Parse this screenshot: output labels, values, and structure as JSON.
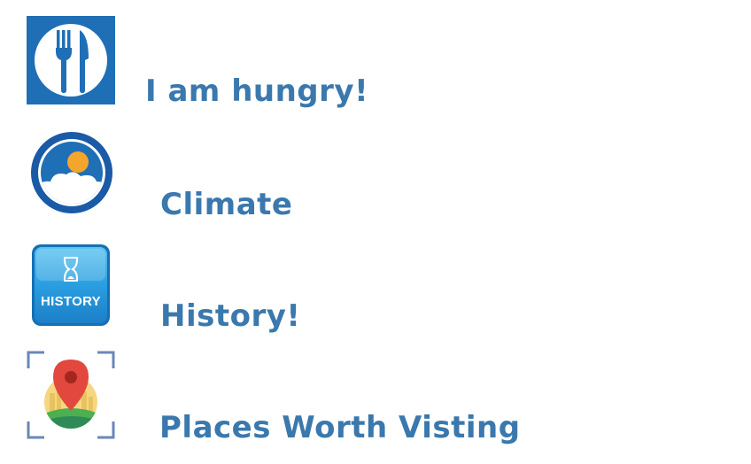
{
  "menu": {
    "items": [
      {
        "label": "I am hungry!",
        "icon": "fork-knife-icon"
      },
      {
        "label": "Climate",
        "icon": "sun-cloud-icon"
      },
      {
        "label": "History!",
        "icon": "hourglass-history-icon",
        "icon_text": "HISTORY"
      },
      {
        "label": "Places Worth Visting",
        "icon": "map-pin-icon"
      }
    ]
  },
  "colors": {
    "label": "#3a78ad",
    "icon_blue": "#1f6fb6",
    "sun": "#f4a52b",
    "pin_red": "#e2483d"
  }
}
